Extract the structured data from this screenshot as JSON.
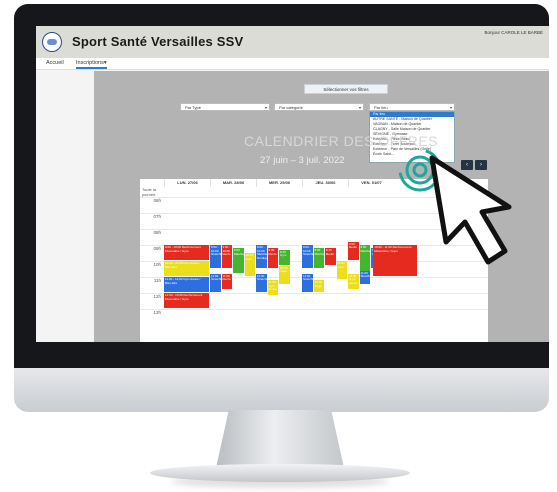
{
  "app": {
    "title": "Sport Santé Versailles SSV",
    "greeting": "Bonjour CAROLE LE BARBE"
  },
  "nav": [
    {
      "label": "Accueil",
      "active": false
    },
    {
      "label": "Inscriptions▾",
      "active": true
    }
  ],
  "filters": {
    "title": "Sélectionner vos filtres",
    "type_select": "Par Type",
    "category_select": "Par catégorie",
    "place_select": "Par lieu",
    "place_options": [
      "Par lieu",
      "AUTRE SANTÉ - Maison de Quartier",
      "VAGBAN - Maison de Quartier",
      "CLAGNY - Salle Maison de Quartier",
      "SÉVIGNÉ - Gymnase",
      "Extérieur - Pièce d'eau",
      "Extérieur - Forêt Bouleaux",
      "Extérieur - Parc de Versailles (Grille)",
      "École Saint-..."
    ]
  },
  "calendar": {
    "title": "CALENDRIER DES OFFRES",
    "range": "27 juin – 3 juil. 2022",
    "prev_label": "‹",
    "next_label": "›",
    "days": [
      "LUN. 27/06",
      "MAR. 28/06",
      "MER. 29/06",
      "JEU. 30/06",
      "VEN. 01/07"
    ],
    "all_day_label": "Toute la journée",
    "hours": [
      "06h",
      "07h",
      "08h",
      "09h",
      "10h",
      "11h",
      "12h",
      "13h"
    ],
    "legend_colors": {
      "red": "#e52b1f",
      "blue": "#2e6fe0",
      "green": "#43b52f",
      "yellow": "#ecde1c"
    }
  },
  "events": [
    {
      "day": 0,
      "text": "9:00 - 10:00 Renforcement Musculaire / Gym",
      "color": "#e52b1f",
      "start": 9.0,
      "end": 10.0,
      "col": 0,
      "cols": 1
    },
    {
      "day": 0,
      "text": "10:00 - 11:00 Gym douce / Bien-être",
      "color": "#ecde1c",
      "start": 10.0,
      "end": 11.0,
      "col": 0,
      "cols": 1
    },
    {
      "day": 0,
      "text": "11:00 - 12:00 Gym douce / Bien-être",
      "color": "#2e6fe0",
      "start": 11.0,
      "end": 12.0,
      "col": 0,
      "cols": 1
    },
    {
      "day": 0,
      "text": "12:00 - 13:00 Renforcement Musculaire / Gym",
      "color": "#e52b1f",
      "start": 12.0,
      "end": 13.0,
      "col": 0,
      "cols": 1
    },
    {
      "day": 1,
      "text": "9:00 - 10:00 Stretching",
      "color": "#2e6fe0",
      "start": 9.0,
      "end": 10.5,
      "col": 0,
      "cols": 4
    },
    {
      "day": 1,
      "text": "9:00 - 10:00 Renfo",
      "color": "#e52b1f",
      "start": 9.0,
      "end": 10.5,
      "col": 1,
      "cols": 4
    },
    {
      "day": 1,
      "text": "9:00 Marche",
      "color": "#43b52f",
      "start": 9.2,
      "end": 10.8,
      "col": 2,
      "cols": 4
    },
    {
      "day": 1,
      "text": "10:15 Gym",
      "color": "#ecde1c",
      "start": 9.5,
      "end": 11.0,
      "col": 3,
      "cols": 4
    },
    {
      "day": 1,
      "text": "11:00 Stretching",
      "color": "#2e6fe0",
      "start": 10.8,
      "end": 12.0,
      "col": 0,
      "cols": 4
    },
    {
      "day": 1,
      "text": "11:00 Renfo",
      "color": "#e52b1f",
      "start": 10.8,
      "end": 11.8,
      "col": 1,
      "cols": 4
    },
    {
      "day": 2,
      "text": "9:00 - 10:00 Marche Nordique",
      "color": "#2e6fe0",
      "start": 9.0,
      "end": 10.5,
      "col": 0,
      "cols": 4
    },
    {
      "day": 2,
      "text": "9:00 Renfo",
      "color": "#e52b1f",
      "start": 9.2,
      "end": 10.5,
      "col": 1,
      "cols": 4
    },
    {
      "day": 2,
      "text": "9:15 Gym",
      "color": "#43b52f",
      "start": 9.3,
      "end": 10.3,
      "col": 2,
      "cols": 4
    },
    {
      "day": 2,
      "text": "10:00 Yoga",
      "color": "#ecde1c",
      "start": 10.3,
      "end": 11.5,
      "col": 2,
      "cols": 4
    },
    {
      "day": 2,
      "text": "11:00 Stretching",
      "color": "#2e6fe0",
      "start": 10.8,
      "end": 12.0,
      "col": 0,
      "cols": 4
    },
    {
      "day": 2,
      "text": "11:00 Gym douce",
      "color": "#ecde1c",
      "start": 11.2,
      "end": 12.2,
      "col": 1,
      "cols": 4
    },
    {
      "day": 3,
      "text": "9:00 - 10:00 Stretching",
      "color": "#2e6fe0",
      "start": 9.0,
      "end": 10.5,
      "col": 0,
      "cols": 4
    },
    {
      "day": 3,
      "text": "9:00 Marche",
      "color": "#43b52f",
      "start": 9.2,
      "end": 10.5,
      "col": 1,
      "cols": 4
    },
    {
      "day": 3,
      "text": "9:15 Renfo",
      "color": "#e52b1f",
      "start": 9.2,
      "end": 10.3,
      "col": 2,
      "cols": 4
    },
    {
      "day": 3,
      "text": "10:00 Gym",
      "color": "#ecde1c",
      "start": 10.0,
      "end": 11.2,
      "col": 3,
      "cols": 4
    },
    {
      "day": 3,
      "text": "11:00 Stretching",
      "color": "#2e6fe0",
      "start": 10.8,
      "end": 12.0,
      "col": 0,
      "cols": 4
    },
    {
      "day": 3,
      "text": "11:00 Yoga",
      "color": "#ecde1c",
      "start": 11.2,
      "end": 12.0,
      "col": 1,
      "cols": 4
    },
    {
      "day": 4,
      "text": "9:00 Renfo",
      "color": "#e52b1f",
      "start": 8.8,
      "end": 10.0,
      "col": 0,
      "cols": 4
    },
    {
      "day": 4,
      "text": "9:00 Marche",
      "color": "#43b52f",
      "start": 9.0,
      "end": 10.8,
      "col": 1,
      "cols": 4
    },
    {
      "day": 4,
      "text": "9:15 Gym",
      "color": "#2e6fe0",
      "start": 9.2,
      "end": 10.5,
      "col": 2,
      "cols": 4
    },
    {
      "day": 4,
      "text": "9:00 Yoga",
      "color": "#ecde1c",
      "start": 9.0,
      "end": 10.3,
      "col": 3,
      "cols": 4
    },
    {
      "day": 4,
      "text": "10:00 - 11:00 Renforcement Musculaire / Gym",
      "color": "#e52b1f",
      "start": 9.0,
      "end": 11.0,
      "col": 4,
      "cols": 4,
      "wide": true
    },
    {
      "day": 4,
      "text": "11:00 Gym douce",
      "color": "#ecde1c",
      "start": 10.8,
      "end": 11.8,
      "col": 0,
      "cols": 4
    },
    {
      "day": 4,
      "text": "11:00 Stretching",
      "color": "#2e6fe0",
      "start": 10.6,
      "end": 11.5,
      "col": 1,
      "cols": 4
    }
  ]
}
